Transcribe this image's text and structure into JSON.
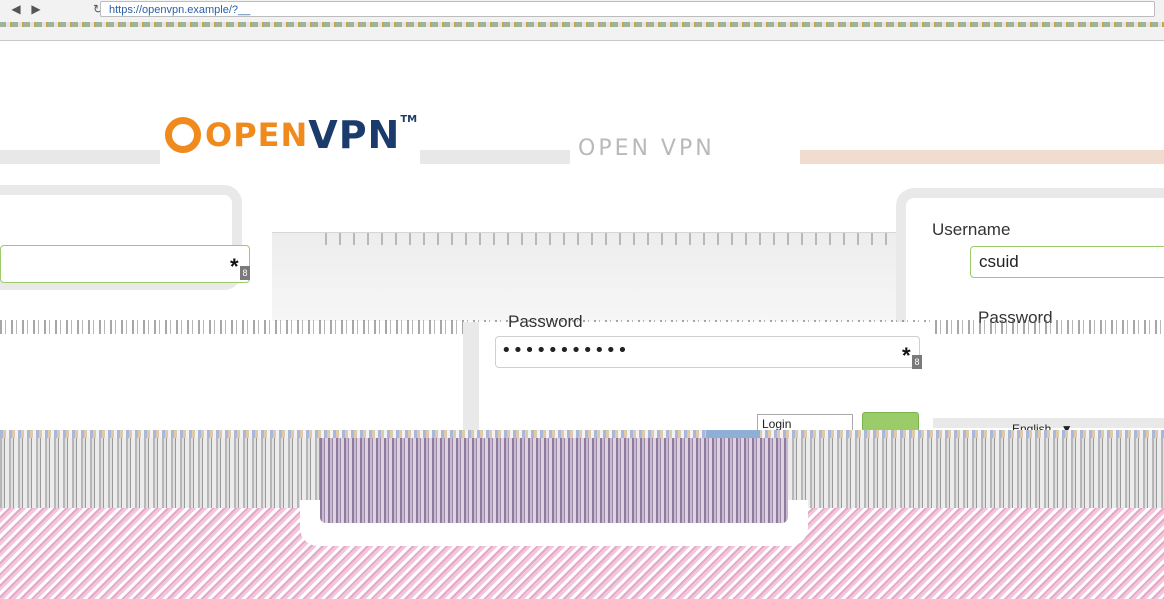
{
  "browser": {
    "url": "https://openvpn.example/?__",
    "back_icon": "arrow-left-icon",
    "reload_icon": "reload-icon"
  },
  "logo": {
    "open": "OPEN",
    "vpn": "VPN",
    "tm": "TM",
    "ghost": "OPEN VPN"
  },
  "form": {
    "username_label": "Username",
    "username_value": "csuid",
    "password_label": "Password",
    "password_value": "•••••••••••",
    "required_mark": "*",
    "badge_text": "8",
    "login_select": "Login",
    "go_label": "",
    "language_select": "English",
    "language_arrow": "▼"
  },
  "colors": {
    "brand_orange": "#f08a1d",
    "brand_navy": "#1a3b6b",
    "accent_green": "#9acd6a"
  }
}
